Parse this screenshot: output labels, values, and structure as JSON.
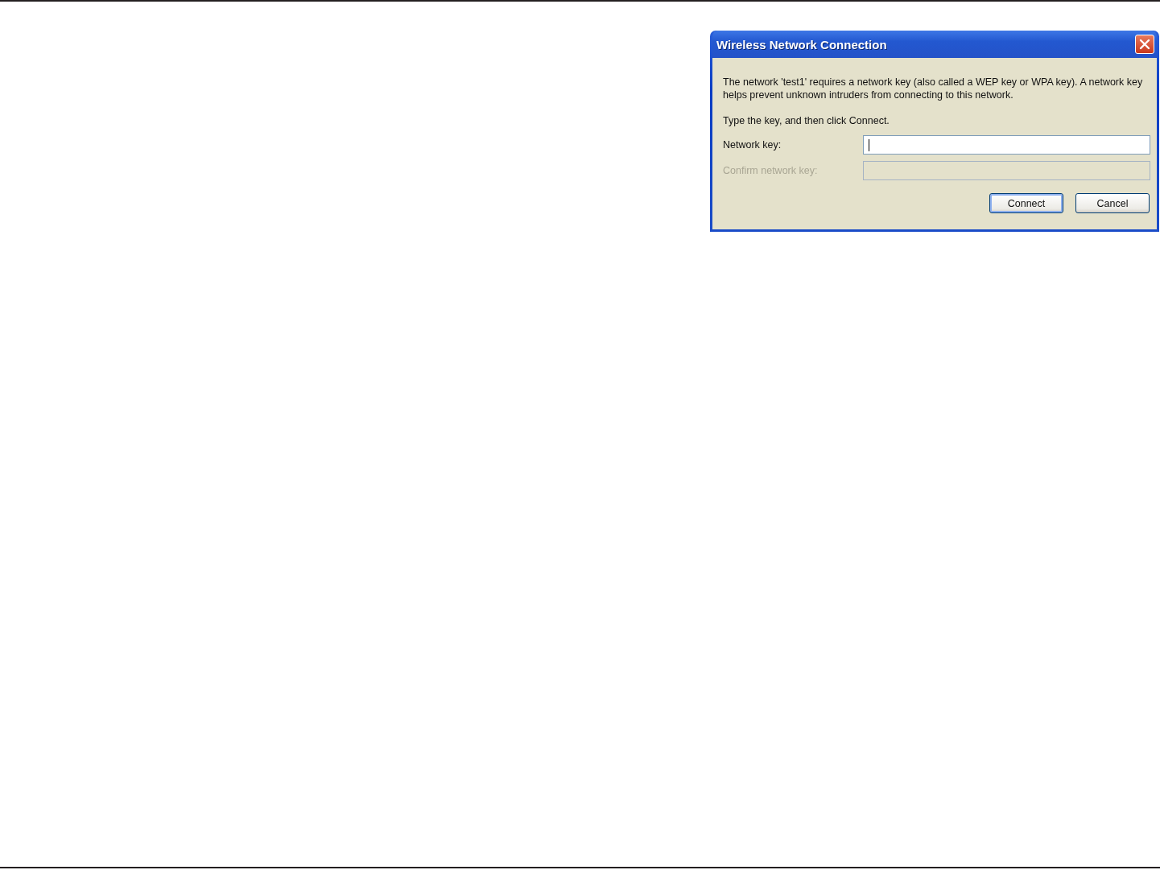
{
  "dialog": {
    "title": "Wireless Network Connection",
    "message": "The network 'test1' requires a network key (also called a WEP key or WPA key). A network key helps prevent unknown intruders from connecting to this network.",
    "instruction": "Type the key, and then click Connect.",
    "fields": [
      {
        "label": "Network key:",
        "disabled": false,
        "focused": true
      },
      {
        "label": "Confirm network key:",
        "disabled": true,
        "focused": false
      }
    ],
    "buttons": [
      {
        "label": "Connect",
        "default": true
      },
      {
        "label": "Cancel",
        "default": false
      }
    ]
  }
}
